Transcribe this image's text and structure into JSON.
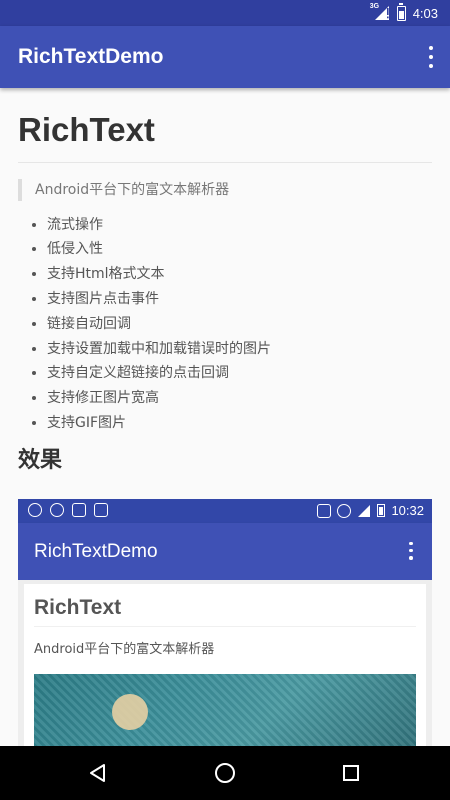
{
  "status_bar": {
    "network_label": "3G",
    "time": "4:03"
  },
  "app_bar": {
    "title": "RichTextDemo",
    "overflow_icon": "more-vert-icon"
  },
  "content": {
    "heading": "RichText",
    "quote": "Android平台下的富文本解析器",
    "features": [
      "流式操作",
      "低侵入性",
      "支持Html格式文本",
      "支持图片点击事件",
      "链接自动回调",
      "支持设置加载中和加载错误时的图片",
      "支持自定义超链接的点击回调",
      "支持修正图片宽高",
      "支持GIF图片"
    ],
    "section_title": "效果"
  },
  "screenshot": {
    "status_time": "10:32",
    "app_title": "RichTextDemo",
    "heading": "RichText",
    "subtitle": "Android平台下的富文本解析器"
  },
  "nav_bar": {
    "back_icon": "back-triangle-icon",
    "home_icon": "home-circle-icon",
    "recents_icon": "recents-square-icon"
  },
  "colors": {
    "primary": "#3f51b5",
    "primary_dark": "#303f9f"
  }
}
